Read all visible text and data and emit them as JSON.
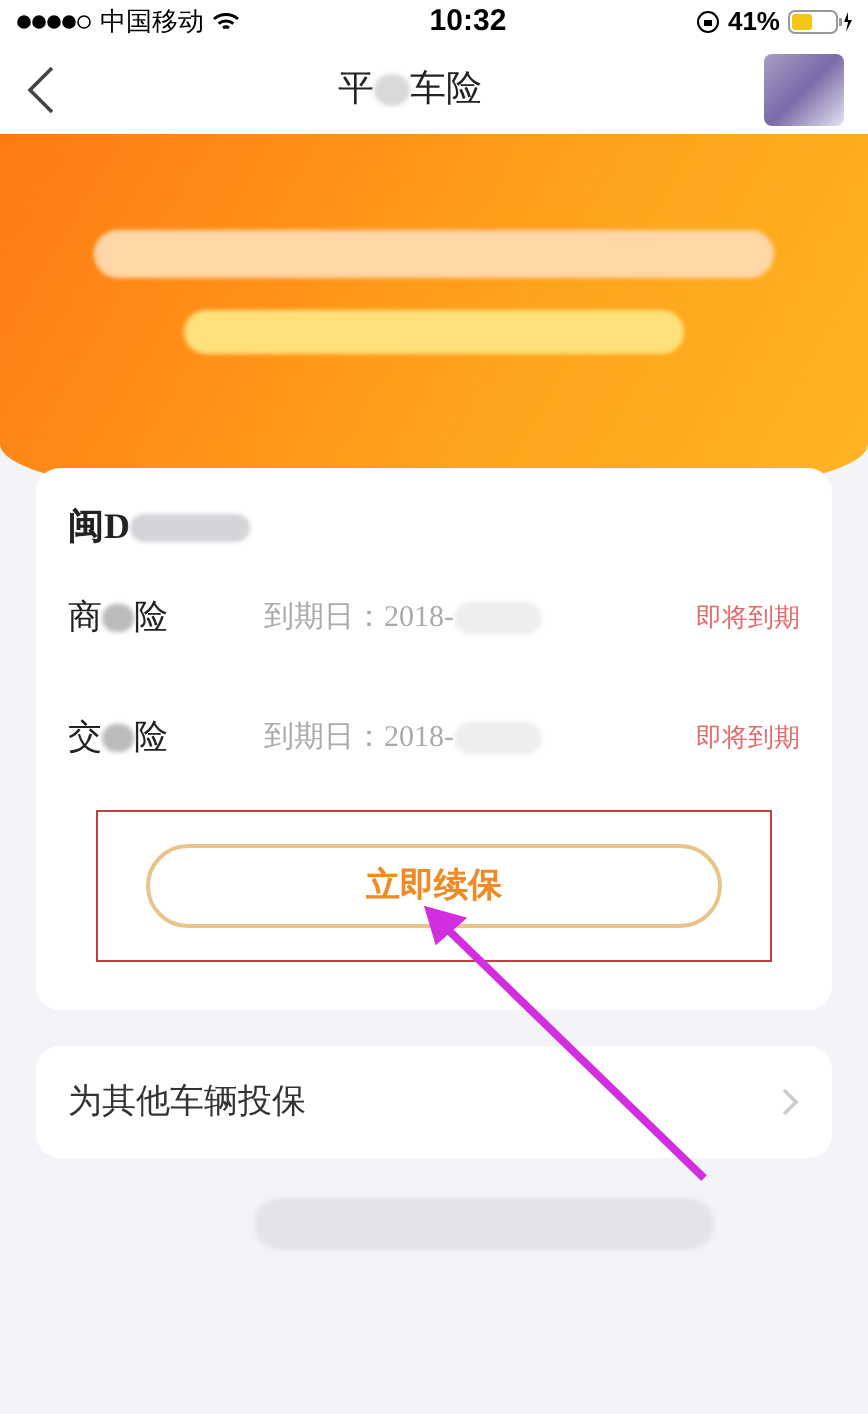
{
  "status_bar": {
    "carrier": "中国移动",
    "time": "10:32",
    "battery": "41%"
  },
  "nav": {
    "title_parts": [
      "平",
      "车险"
    ]
  },
  "policy_card": {
    "plate": "闽D",
    "rows": [
      {
        "name_parts": [
          "商",
          "险"
        ],
        "expiry_label": "到期日：2018-",
        "status": "即将到期"
      },
      {
        "name_parts": [
          "交",
          "险"
        ],
        "expiry_label": "到期日：2018-",
        "status": "即将到期"
      }
    ],
    "renew_button": "立即续保",
    "highlighted": true
  },
  "other_vehicle": {
    "label": "为其他车辆投保"
  }
}
